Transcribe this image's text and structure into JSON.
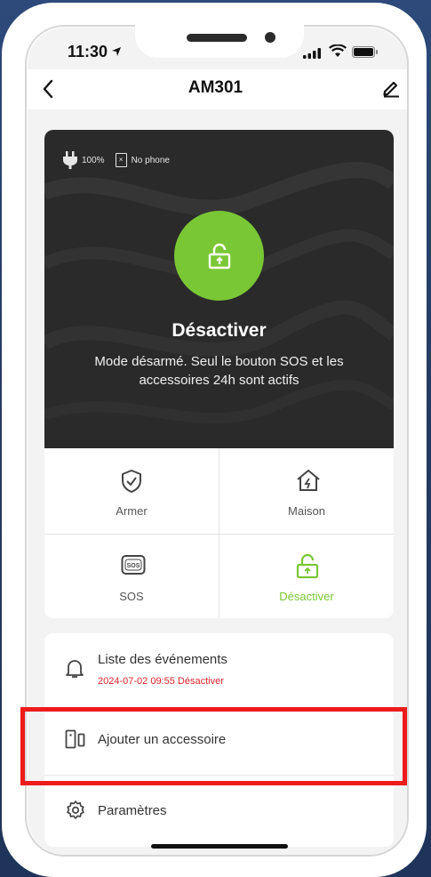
{
  "status_bar": {
    "time": "11:30"
  },
  "header": {
    "title": "AM301"
  },
  "hero": {
    "battery_text": "100%",
    "phone_text": "No phone",
    "mode_title": "Désactiver",
    "mode_description": "Mode désarmé. Seul le bouton SOS et les accessoires 24h sont actifs"
  },
  "modes": {
    "arm": "Armer",
    "home": "Maison",
    "sos": "SOS",
    "sos_badge": "SOS",
    "disarm": "Désactiver"
  },
  "menu": {
    "events_label": "Liste des événements",
    "events_last": "2024-07-02 09:55 Désactiver",
    "add_accessory_label": "Ajouter un accessoire",
    "settings_label": "Paramètres"
  },
  "colors": {
    "accent_green": "#7ac735",
    "event_red": "#e0262d",
    "highlight": "#ee1b1b"
  }
}
